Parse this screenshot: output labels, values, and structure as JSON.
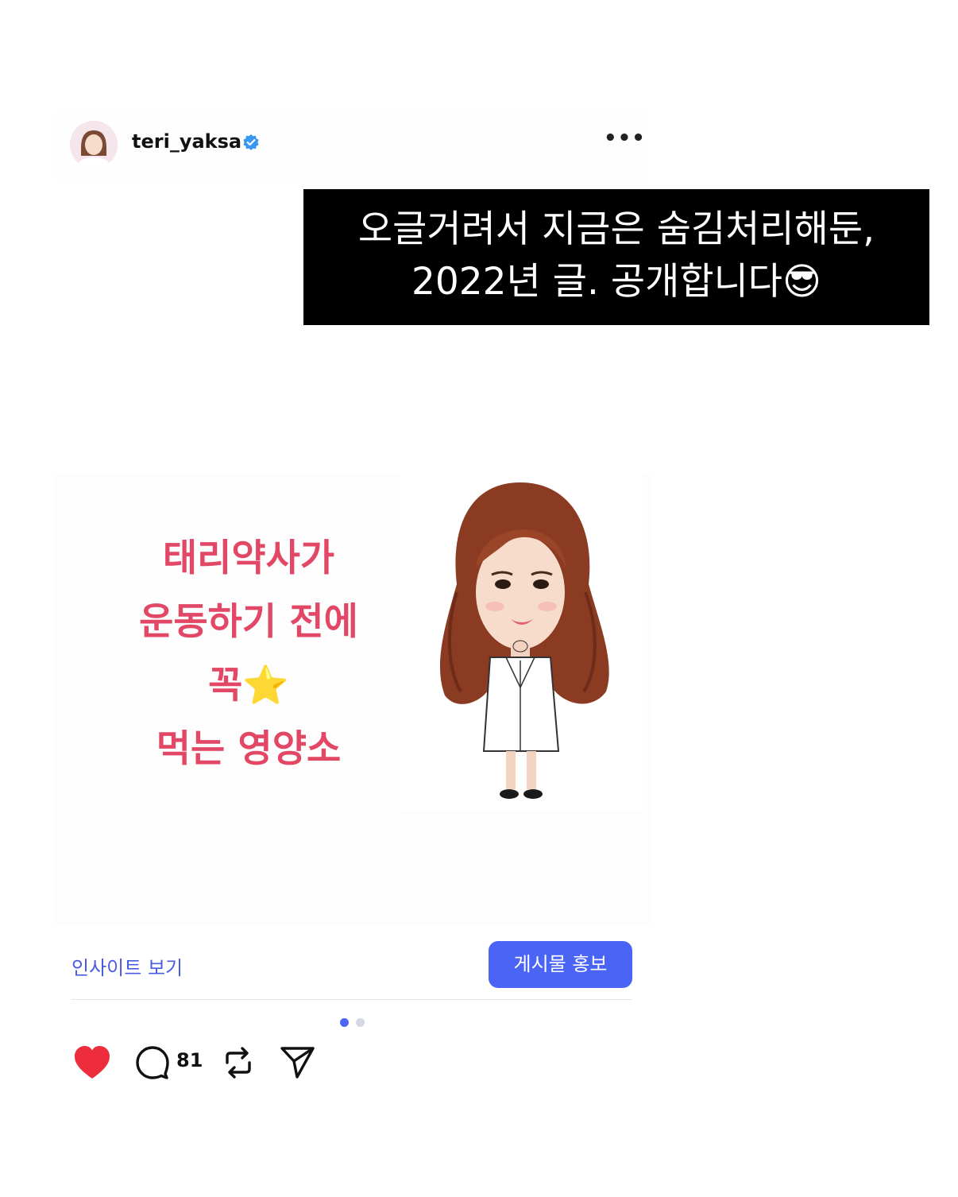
{
  "post": {
    "username": "teri_yaksa",
    "more_label": "•••"
  },
  "caption": {
    "line1": "오글거려서 지금은 숨김처리해둔,",
    "line2": "2022년 글. 공개합니다😎"
  },
  "media": {
    "headline": [
      "태리약사가",
      "운동하기 전에",
      "꼭⭐️",
      "먹는 영양소"
    ]
  },
  "insights": {
    "view_label": "인사이트 보기",
    "promote_label": "게시물 홍보"
  },
  "actions": {
    "comment_count": "81"
  },
  "carousel": {
    "current": 1,
    "total": 2
  },
  "colors": {
    "accent": "#4a64f5",
    "headline": "#e24766",
    "like": "#ed2d3c",
    "verified": "#3897f0"
  }
}
